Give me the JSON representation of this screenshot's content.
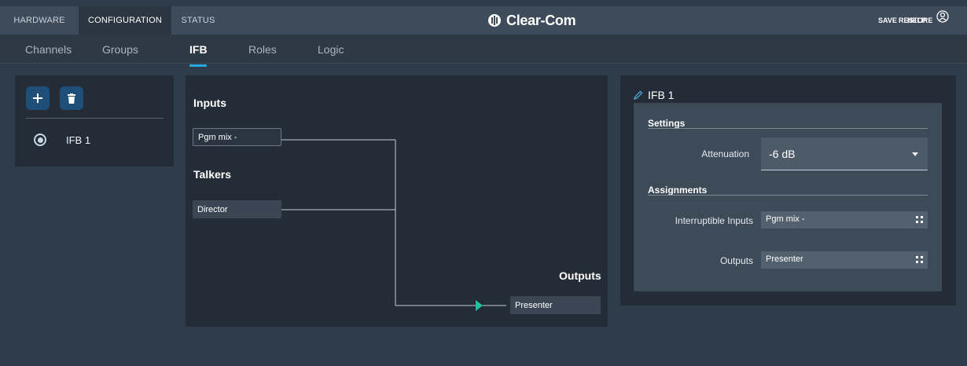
{
  "topbar": {
    "tabs": [
      {
        "label": "HARDWARE"
      },
      {
        "label": "CONFIGURATION"
      },
      {
        "label": "STATUS"
      }
    ],
    "logo": "Clear-Com",
    "actions": {
      "save": "SAVE",
      "restore": "RESTORE",
      "help": "HELP"
    },
    "user_icon": "user-circle-icon"
  },
  "subtabs": [
    {
      "label": "Channels"
    },
    {
      "label": "Groups"
    },
    {
      "label": "IFB"
    },
    {
      "label": "Roles"
    },
    {
      "label": "Logic"
    }
  ],
  "left_panel": {
    "add_icon": "plus-icon",
    "delete_icon": "trash-icon",
    "items": [
      {
        "label": "IFB 1",
        "selected": true
      }
    ]
  },
  "graph": {
    "inputs_heading": "Inputs",
    "talkers_heading": "Talkers",
    "outputs_heading": "Outputs",
    "input_node": "Pgm mix -",
    "talker_node": "Director",
    "output_node": "Presenter"
  },
  "details": {
    "title": "IFB 1",
    "edit_icon": "pencil-icon",
    "settings_heading": "Settings",
    "attenuation_label": "Attenuation",
    "attenuation_value": "-6 dB",
    "assignments_heading": "Assignments",
    "interruptible_label": "Interruptible Inputs",
    "interruptible_value": "Pgm mix -",
    "outputs_label": "Outputs",
    "outputs_value": "Presenter"
  },
  "colors": {
    "accent": "#29a8e0",
    "arrow": "#1fc3a0",
    "button": "#1f4e78",
    "background": "#2f3c4a"
  }
}
